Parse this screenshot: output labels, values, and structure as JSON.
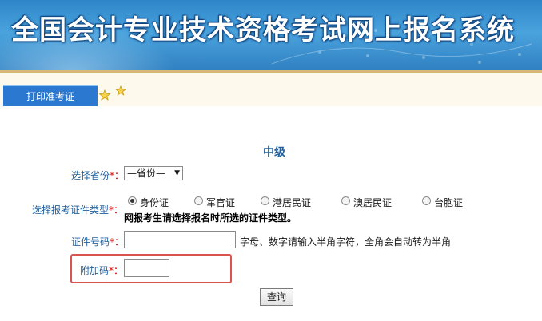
{
  "header": {
    "title": "全国会计专业技术资格考试网上报名系统"
  },
  "tabs": [
    {
      "label": "打印准考证"
    }
  ],
  "form": {
    "heading": "中级",
    "province": {
      "label": "选择省份",
      "required_mark": "*：",
      "selected": "—省份—"
    },
    "id_type": {
      "label": "选择报考证件类型",
      "required_mark": "*：",
      "options": [
        "身份证",
        "军官证",
        "港居民证",
        "澳居民证",
        "台胞证"
      ],
      "selected": "身份证",
      "note": "网报考生请选择报名时所选的证件类型。"
    },
    "id_number": {
      "label": "证件号码",
      "required_mark": "*：",
      "value": "",
      "hint": "字母、数字请输入半角字符，全角会自动转为半角"
    },
    "captcha": {
      "label": "附加码",
      "required_mark": "*：",
      "value": ""
    },
    "submit_label": "查询"
  },
  "colors": {
    "accent": "#2b78d0",
    "label": "#1f5f9e",
    "highlight": "#d9534f"
  }
}
